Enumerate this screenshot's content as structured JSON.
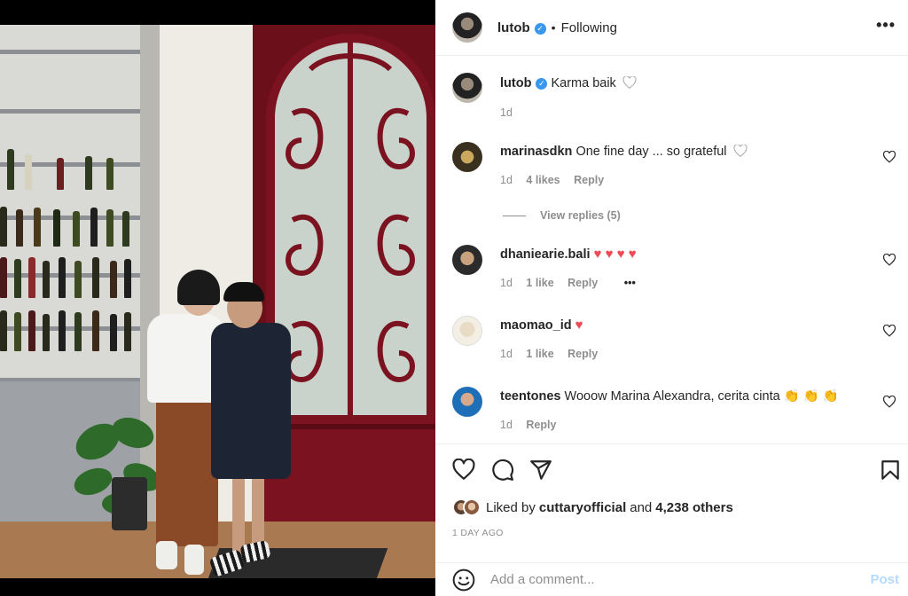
{
  "post": {
    "author": "lutob",
    "follow_status": "Following",
    "separator": "•",
    "more_label": "•••"
  },
  "caption": {
    "author": "lutob",
    "text": "Karma baik",
    "age": "1d"
  },
  "comments": [
    {
      "user": "marinasdkn",
      "text": "One fine day ... so grateful",
      "age": "1d",
      "likes": "4 likes",
      "reply": "Reply",
      "view_replies": "View replies (5)"
    },
    {
      "user": "dhaniearie.bali",
      "text": "♥ ♥ ♥ ♥",
      "age": "1d",
      "likes": "1 like",
      "reply": "Reply",
      "more": "•••"
    },
    {
      "user": "maomao_id",
      "text": "♥",
      "age": "1d",
      "likes": "1 like",
      "reply": "Reply"
    },
    {
      "user": "teentones",
      "text": "Wooow Marina Alexandra, cerita cinta 👏 👏 👏",
      "age": "1d",
      "reply": "Reply"
    }
  ],
  "likes": {
    "prefix": "Liked by",
    "user": "cuttaryofficial",
    "and": "and",
    "others": "4,238 others"
  },
  "timestamp": "1 DAY AGO",
  "add_comment": {
    "placeholder": "Add a comment...",
    "post_label": "Post"
  },
  "colors": {
    "verified": "#3897f0",
    "heart_red": "#ed4956",
    "post_disabled": "#b3dbff",
    "door": "#6b0f1a"
  },
  "icons": [
    "verified-badge-icon",
    "more-options-icon",
    "heart-icon",
    "comment-icon",
    "share-icon",
    "bookmark-icon",
    "emoji-icon"
  ]
}
